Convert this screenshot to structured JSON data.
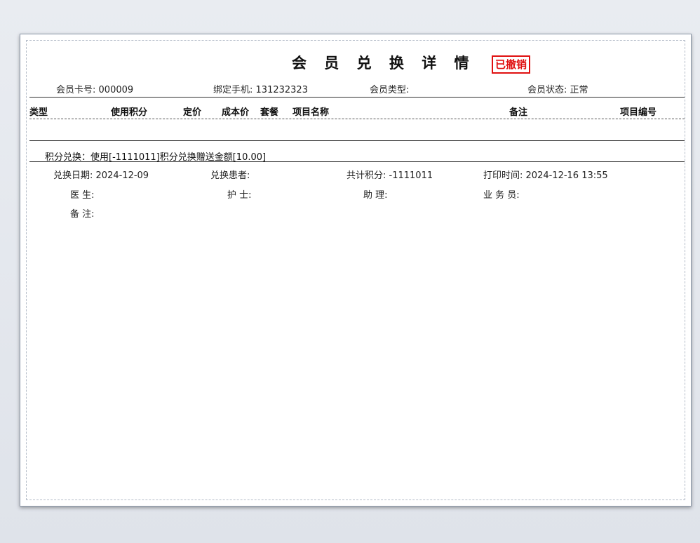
{
  "report": {
    "title": "会 员 兑 换 详 情",
    "stamp": "已撤销",
    "info": {
      "card_label": "会员卡号:",
      "card_value": "000009",
      "phone_label": "绑定手机:",
      "phone_value": "131232323",
      "type_label": "会员类型:",
      "type_value": "",
      "status_label": "会员状态:",
      "status_value": "正常"
    },
    "columns": [
      "类型",
      "使用积分",
      "定价",
      "成本价",
      "套餐",
      "项目名称",
      "备注",
      "项目编号"
    ],
    "exchange_line": "积分兑换：使用[-1111011]积分兑换赠送金额[10.00]",
    "details": {
      "date_label": "兑换日期:",
      "date_value": "2024-12-09",
      "patient_label": "兑换患者:",
      "patient_value": "",
      "total_label": "共计积分:",
      "total_value": "-1111011",
      "print_label": "打印时间:",
      "print_value": "2024-12-16 13:55",
      "doctor_label": "医 生:",
      "nurse_label": "护 士:",
      "assistant_label": "助 理:",
      "sales_label": "业 务 员:",
      "remark_label": "备 注:"
    }
  }
}
